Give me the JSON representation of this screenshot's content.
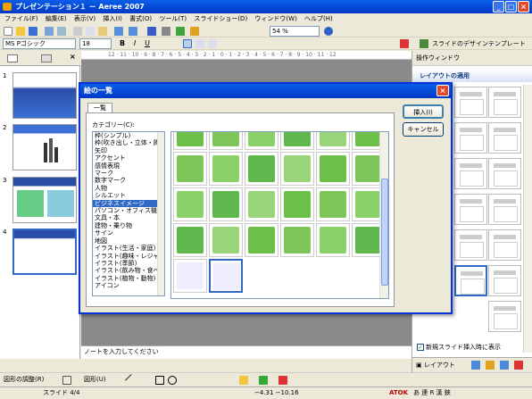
{
  "window": {
    "title": "プレゼンテーション１ － Aeree 2007"
  },
  "menu": [
    "ファイル(F)",
    "編集(E)",
    "表示(V)",
    "挿入(I)",
    "書式(O)",
    "ツール(T)",
    "スライドショー(D)",
    "ウィンドウ(W)",
    "ヘルプ(H)"
  ],
  "toolbar": {
    "zoom": "54 %",
    "font": "MS Pゴシック",
    "font_size": "18",
    "design_template": "スライドのデザインテンプレート"
  },
  "slides_pane": {
    "numbers": [
      "1",
      "2",
      "3",
      "4"
    ]
  },
  "ruler": {
    "text": "12 · 11 · 10 · 9 · 8 · 7 · 6 · 5 · 4 · 3 · 2 · 1 · 0 · 1 · 2 · 3 · 4 · 5 · 6 · 7 · 8 · 9 · 10 · 11 · 12"
  },
  "notes": {
    "placeholder": "ノートを入力してください"
  },
  "taskpane": {
    "header": "操作ウィンドウ",
    "section": "レイアウトの適用",
    "checkbox_label": "新規スライド挿入時に表示",
    "tab_layout": "レイアウト"
  },
  "dialog": {
    "title": "絵の一覧",
    "tab": "一覧",
    "category_label": "カテゴリー(C):",
    "categories": [
      "枠(シンプル)",
      "枠(吹き出し・立体・飾り)",
      "矢印",
      "アクセント",
      "感情表現",
      "マーク",
      "数字マーク",
      "人物",
      "シルエット",
      "ビジネスイメージ",
      "パソコン・オフィス機器",
      "文具・本",
      "建物・乗り物",
      "サイン",
      "地図",
      "イラスト(生活・家庭)",
      "イラスト(趣味・レジャー)",
      "イラスト(季節)",
      "イラスト(飲み物・食べ物)",
      "イラスト(植物・動物)",
      "アイコン"
    ],
    "selected_category": "ビジネスイメージ",
    "insert_button": "挿入(I)",
    "cancel_button": "キャンセル"
  },
  "drawbar": {
    "left": "図形の調整(R)",
    "autoshape": "図形(U)"
  },
  "statusbar": {
    "slide": "スライド 4/4",
    "coords": "−4.31  −10.16"
  },
  "ime": {
    "label": "ATOK",
    "text": "あ 連 R 漢 鋏"
  }
}
